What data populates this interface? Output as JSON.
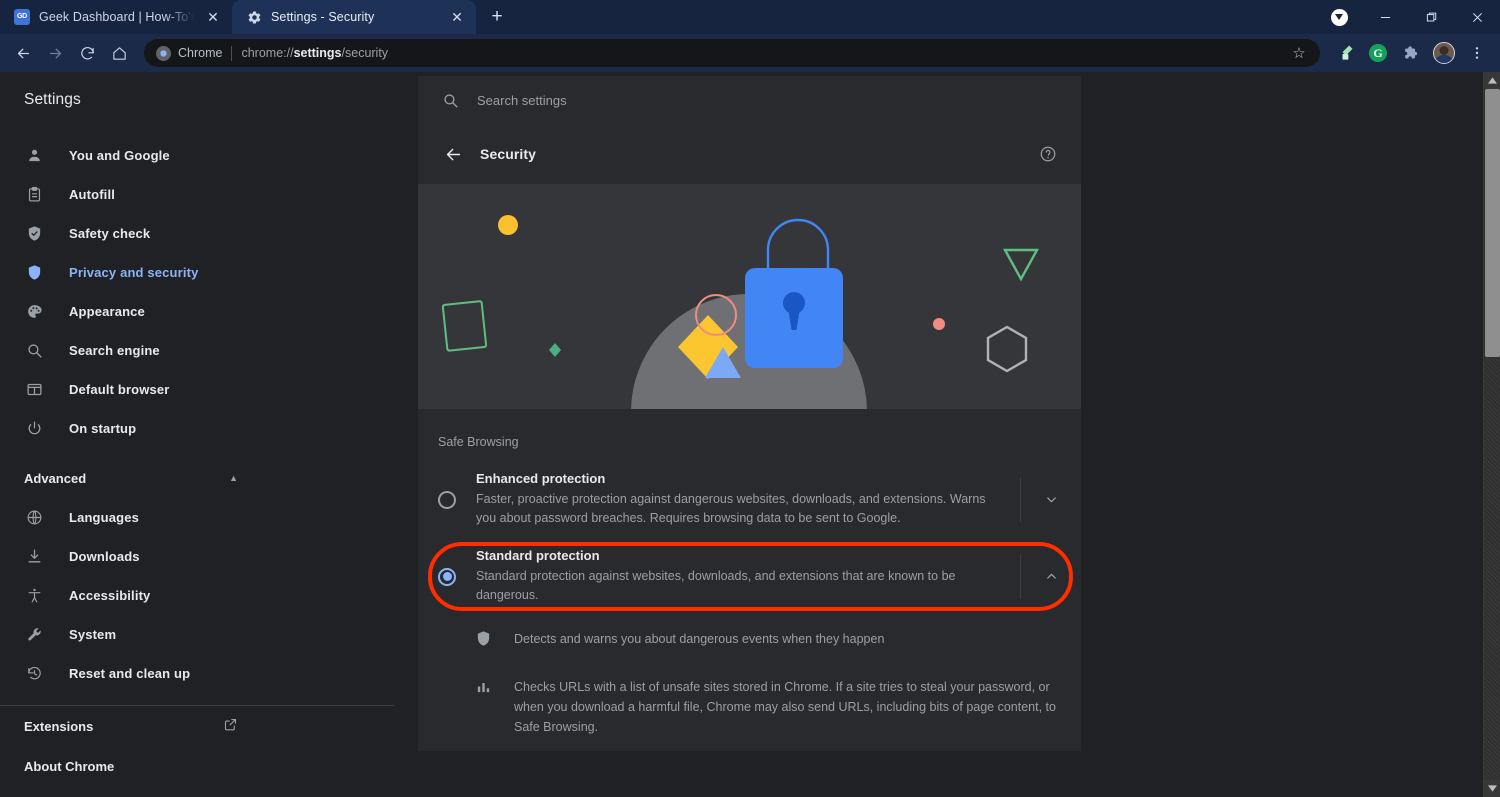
{
  "browser": {
    "tabs": [
      {
        "title": "Geek Dashboard | How-To's, Sma",
        "favicon_label": "GD",
        "favicon": "gd-favicon",
        "active": false,
        "close_label": "✕"
      },
      {
        "title": "Settings - Security",
        "favicon_label": "",
        "favicon": "gear-icon",
        "active": true,
        "close_label": "✕"
      }
    ],
    "new_tab_label": "+",
    "window_controls": {
      "cast": "cast-icon",
      "minimize": "—",
      "maximize": "❐",
      "close": "✕"
    },
    "toolbar": {
      "back": "←",
      "forward": "→",
      "reload": "⟳",
      "home": "⌂",
      "omnibox": {
        "chip_label": "Chrome",
        "url_prefix": "chrome://",
        "url_bold": "settings",
        "url_suffix": "/security"
      },
      "bookmark_star": "☆",
      "extension_icons": [
        "eyedropper-icon",
        "grammarly-icon",
        "puzzle-extensions-icon",
        "profile-avatar"
      ],
      "grammarly_label": "G",
      "menu": "⋮"
    }
  },
  "settings": {
    "title": "Settings",
    "search": {
      "placeholder": "Search settings",
      "value": "",
      "icon": "search-icon"
    },
    "sidebar": {
      "items": [
        {
          "label": "You and Google",
          "icon": "person-icon",
          "selected": false
        },
        {
          "label": "Autofill",
          "icon": "clipboard-icon",
          "selected": false
        },
        {
          "label": "Safety check",
          "icon": "shield-check-icon",
          "selected": false
        },
        {
          "label": "Privacy and security",
          "icon": "shield-icon",
          "selected": true
        },
        {
          "label": "Appearance",
          "icon": "palette-icon",
          "selected": false
        },
        {
          "label": "Search engine",
          "icon": "search-icon",
          "selected": false
        },
        {
          "label": "Default browser",
          "icon": "browser-window-icon",
          "selected": false
        },
        {
          "label": "On startup",
          "icon": "power-icon",
          "selected": false
        }
      ],
      "advanced": {
        "label": "Advanced",
        "caret": "▲",
        "expanded": true
      },
      "advanced_items": [
        {
          "label": "Languages",
          "icon": "globe-icon"
        },
        {
          "label": "Downloads",
          "icon": "download-icon"
        },
        {
          "label": "Accessibility",
          "icon": "accessibility-icon"
        },
        {
          "label": "System",
          "icon": "wrench-icon"
        },
        {
          "label": "Reset and clean up",
          "icon": "history-restore-icon"
        }
      ],
      "extensions": {
        "label": "Extensions",
        "icon": "external-link-icon"
      },
      "about": {
        "label": "About Chrome"
      }
    },
    "page": {
      "back": "←",
      "heading": "Security",
      "help_icon": "help-circle-icon",
      "hero_illustration": "security-lock-illustration",
      "group_label": "Safe Browsing",
      "options": [
        {
          "title": "Enhanced protection",
          "description": "Faster, proactive protection against dangerous websites, downloads, and extensions. Warns you about password breaches. Requires browsing data to be sent to Google.",
          "selected": false,
          "expanded": false,
          "chevron": "chevron-down-icon",
          "highlighted": false
        },
        {
          "title": "Standard protection",
          "description": "Standard protection against websites, downloads, and extensions that are known to be dangerous.",
          "selected": true,
          "expanded": true,
          "chevron": "chevron-up-icon",
          "highlighted": true
        }
      ],
      "standard_details": [
        {
          "icon": "shield-icon",
          "text": "Detects and warns you about dangerous events when they happen"
        },
        {
          "icon": "bar-chart-icon",
          "text": "Checks URLs with a list of unsafe sites stored in Chrome. If a site tries to steal your password, or when you download a harmful file, Chrome may also send URLs, including bits of page content, to Safe Browsing."
        }
      ]
    },
    "scrollbar": {
      "up": "▲",
      "down": "▼"
    }
  },
  "colors": {
    "accent_blue": "#8ab4f8",
    "highlight_red": "#ff2d00",
    "page_bg": "#202124",
    "card_bg": "#292a2d",
    "hero_bg": "#35363a",
    "tabstrip_bg": "#17243f"
  }
}
